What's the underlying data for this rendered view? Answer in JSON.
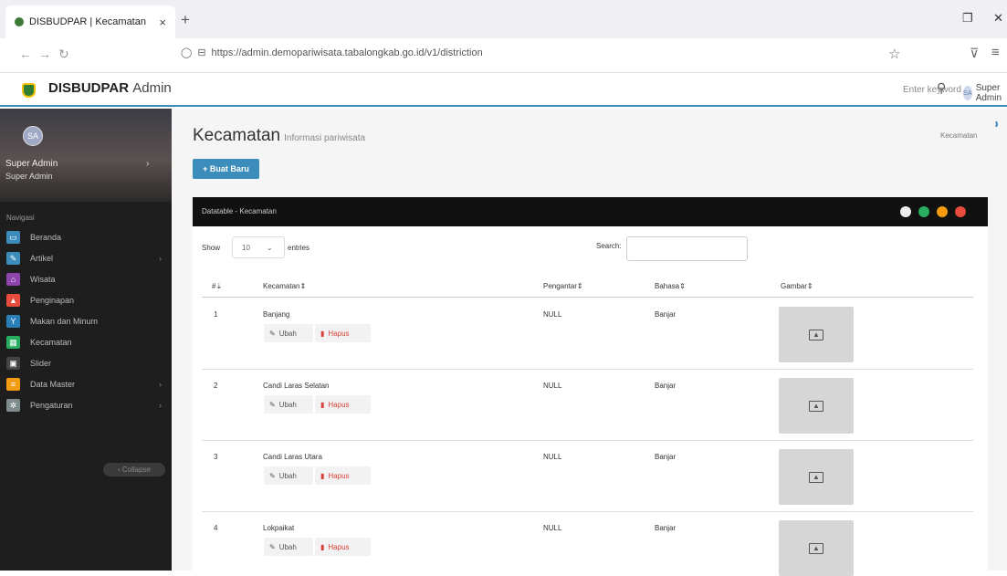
{
  "browser": {
    "tab_title": "DISBUDPAR | Kecamatan",
    "url": "https://admin.demopariwisata.tabalongkab.go.id/v1/distriction"
  },
  "appbar": {
    "brand_bold": "DISBUDPAR",
    "brand_light": "Admin",
    "search_placeholder": "Enter keyword",
    "user_initials": "SA",
    "user_name": "Super Admin"
  },
  "sidebar": {
    "avatar_initials": "SA",
    "user_name": "Super Admin",
    "user_role": "Super Admin",
    "nav_label": "Navigasi",
    "items": [
      {
        "label": "Beranda",
        "icon": "monitor-icon",
        "color": "#3c8dbc"
      },
      {
        "label": "Artikel",
        "icon": "pencil-icon",
        "color": "#3c8dbc",
        "arrow": "›"
      },
      {
        "label": "Wisata",
        "icon": "temple-icon",
        "color": "#8e44ad"
      },
      {
        "label": "Penginapan",
        "icon": "bed-icon",
        "color": "#e74c3c"
      },
      {
        "label": "Makan dan Minum",
        "icon": "drink-icon",
        "color": "#2980b9"
      },
      {
        "label": "Kecamatan",
        "icon": "map-icon",
        "color": "#27ae60"
      },
      {
        "label": "Slider",
        "icon": "image-icon",
        "color": "#444444"
      },
      {
        "label": "Data Master",
        "icon": "database-icon",
        "color": "#f39c12",
        "arrow": "›"
      },
      {
        "label": "Pengaturan",
        "icon": "gear-icon",
        "color": "#7f8c8d",
        "arrow": "›"
      }
    ],
    "collapse_label": "‹ Collapse"
  },
  "page": {
    "title": "Kecamatan",
    "subtitle": "Informasi pariwisata",
    "breadcrumb": "Kecamatan",
    "new_button": "+ Buat Baru"
  },
  "panel": {
    "title": "Datatable - Kecamatan",
    "show_label": "Show",
    "length_value": "10",
    "entries_label": "entries",
    "search_label": "Search:"
  },
  "table": {
    "headers": [
      "#",
      "Kecamatan",
      "Pengantar",
      "Bahasa",
      "Gambar"
    ],
    "edit_label": "Ubah",
    "delete_label": "Hapus",
    "rows": [
      {
        "no": "1",
        "kecamatan": "Banjang",
        "pengantar": "NULL",
        "bahasa": "Banjar"
      },
      {
        "no": "2",
        "kecamatan": "Candi Laras Selatan",
        "pengantar": "NULL",
        "bahasa": "Banjar"
      },
      {
        "no": "3",
        "kecamatan": "Candi Laras Utara",
        "pengantar": "NULL",
        "bahasa": "Banjar"
      },
      {
        "no": "4",
        "kecamatan": "Lokpaikat",
        "pengantar": "NULL",
        "bahasa": "Banjar"
      }
    ]
  }
}
